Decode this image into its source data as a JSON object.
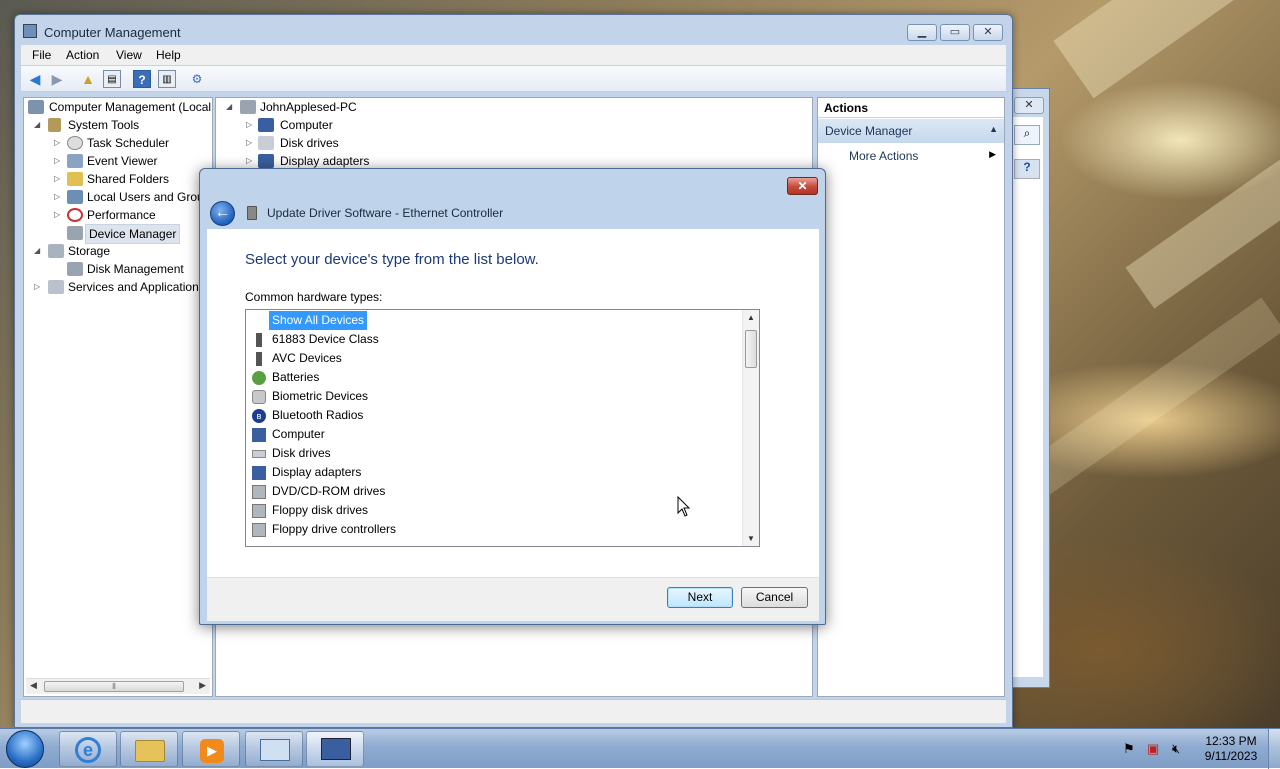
{
  "window": {
    "title": "Computer Management"
  },
  "menu": [
    "File",
    "Action",
    "View",
    "Help"
  ],
  "tree": {
    "root": "Computer Management (Local",
    "items": [
      {
        "label": "System Tools"
      },
      {
        "label": "Task Scheduler"
      },
      {
        "label": "Event Viewer"
      },
      {
        "label": "Shared Folders"
      },
      {
        "label": "Local Users and Group"
      },
      {
        "label": "Performance"
      },
      {
        "label": "Device Manager"
      },
      {
        "label": "Storage"
      },
      {
        "label": "Disk Management"
      },
      {
        "label": "Services and Applications"
      }
    ]
  },
  "devtree": {
    "root": "JohnApplesed-PC",
    "items": [
      "Computer",
      "Disk drives",
      "Display adapters"
    ]
  },
  "actions": {
    "header": "Actions",
    "section": "Device Manager",
    "more": "More Actions"
  },
  "dialog": {
    "title": "Update Driver Software - Ethernet Controller",
    "heading": "Select your device's type from the list below.",
    "list_label": "Common hardware types:",
    "items": [
      "Show All Devices",
      "61883 Device Class",
      "AVC Devices",
      "Batteries",
      "Biometric Devices",
      "Bluetooth Radios",
      "Computer",
      "Disk drives",
      "Display adapters",
      "DVD/CD-ROM drives",
      "Floppy disk drives",
      "Floppy drive controllers"
    ],
    "selected": "Show All Devices",
    "next": "Next",
    "cancel": "Cancel",
    "close": "✕"
  },
  "taskbar": {
    "time": "12:33 PM",
    "date": "9/11/2023"
  },
  "colors": {
    "accent": "#3399ff",
    "heading": "#1a3a78"
  }
}
